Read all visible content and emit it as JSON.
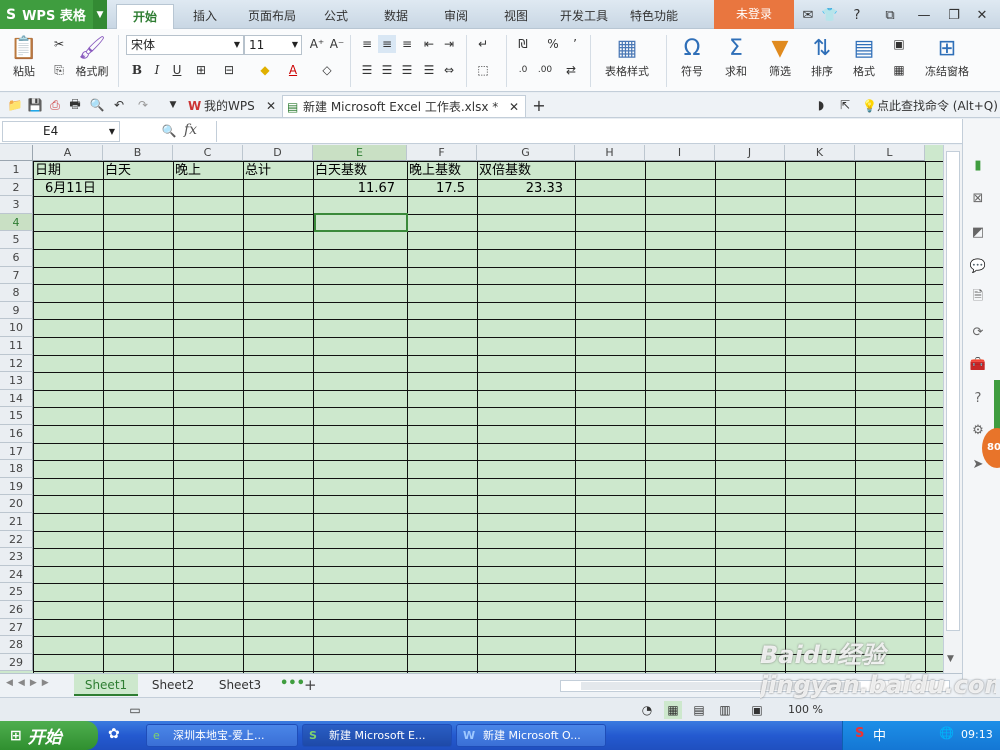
{
  "title_bar": {
    "app_name": "WPS 表格",
    "tabs": [
      "开始",
      "插入",
      "页面布局",
      "公式",
      "数据",
      "审阅",
      "视图",
      "开发工具",
      "特色功能"
    ],
    "active_tab": "开始",
    "login_label": "未登录",
    "help_label": "?"
  },
  "ribbon": {
    "paste": "粘贴",
    "format_painter": "格式刷",
    "font_name": "宋体",
    "font_size": "11",
    "table_style": "表格样式",
    "symbol": "符号",
    "sum": "求和",
    "filter": "筛选",
    "sort": "排序",
    "format": "格式",
    "freeze": "冻结窗格",
    "percent": "%"
  },
  "doc_tabs": {
    "tab1": "我的WPS",
    "tab2": "新建 Microsoft Excel 工作表.xlsx *",
    "search_hint": "点此查找命令 (Alt+Q)"
  },
  "formula_bar": {
    "name_box": "E4",
    "fx": "fx",
    "value": ""
  },
  "columns": [
    "A",
    "B",
    "C",
    "D",
    "E",
    "F",
    "G",
    "H",
    "I",
    "J",
    "K",
    "L"
  ],
  "selected_column": "E",
  "rows": [
    "1",
    "2",
    "3",
    "4",
    "5",
    "6",
    "7",
    "8",
    "9",
    "10",
    "11",
    "12",
    "13",
    "14",
    "15",
    "16",
    "17",
    "18",
    "19",
    "20",
    "21",
    "22",
    "23",
    "24",
    "25",
    "26",
    "27",
    "28",
    "29"
  ],
  "selected_row": "4",
  "cells": {
    "A1": "日期",
    "B1": "白天",
    "C1": "晚上",
    "D1": "总计",
    "E1": "白天基数",
    "F1": "晚上基数",
    "G1": "双倍基数",
    "A2": "6月11日",
    "E2": "11.67",
    "F2": "17.5",
    "G2": "23.33"
  },
  "sheets": {
    "tabs": [
      "Sheet1",
      "Sheet2",
      "Sheet3"
    ],
    "active": "Sheet1"
  },
  "status_bar": {
    "zoom": "100 %"
  },
  "side_badge": "80",
  "taskbar": {
    "start": "开始",
    "tasks": [
      "深圳本地宝-爱上...",
      "新建 Microsoft E...",
      "新建 Microsoft O..."
    ],
    "ime": "中",
    "clock": "09:13"
  },
  "watermark": "Baidu经验 jingyan.baidu.com",
  "colors": {
    "grid_bg": "#cde8cd",
    "accent_green": "#3f9d3f",
    "login_orange": "#e9763f",
    "taskbar_blue": "#245ad0"
  }
}
